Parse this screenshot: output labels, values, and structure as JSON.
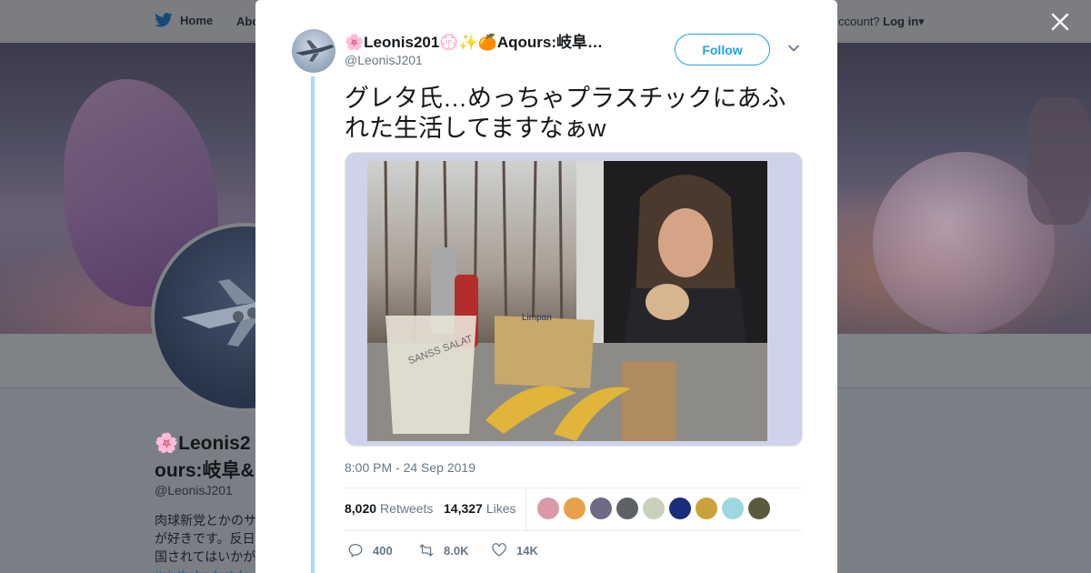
{
  "nav": {
    "home": "Home",
    "about": "Abo",
    "account_prompt": "ccount?",
    "login": "Log in"
  },
  "profile": {
    "name_line1": "🌸Leonis2",
    "name_line2": "ours:岐阜&",
    "handle": "@LeonisJ201",
    "bio_lines": [
      "肉球新党とかのサ",
      "が好きです。反日",
      "国されてはいかが"
    ],
    "bio_link": "#sinthebodystyle"
  },
  "tweet": {
    "author_name": "🌸Leonis201💮✨🍊Aqours:岐阜…",
    "author_handle": "@LeonisJ201",
    "follow_label": "Follow",
    "text": "グレタ氏…めっちゃプラスチックにあふれた生活してますなぁw",
    "timestamp": "8:00 PM - 24 Sep 2019",
    "retweets_count": "8,020",
    "retweets_label": "Retweets",
    "likes_count": "14,327",
    "likes_label": "Likes",
    "actions": {
      "reply_count": "400",
      "retweet_count": "8.0K",
      "like_count": "14K"
    },
    "likers": [
      {
        "name": "liker-avatar-1",
        "color": "#d79aa6"
      },
      {
        "name": "liker-avatar-2",
        "color": "#e8a14a"
      },
      {
        "name": "liker-avatar-3",
        "color": "#6f6a86"
      },
      {
        "name": "liker-avatar-4",
        "color": "#5d6166"
      },
      {
        "name": "liker-avatar-5",
        "color": "#c9d2b9"
      },
      {
        "name": "liker-avatar-6",
        "color": "#1a2d7a"
      },
      {
        "name": "liker-avatar-7",
        "color": "#c9a23b"
      },
      {
        "name": "liker-avatar-8",
        "color": "#9fd7e0"
      },
      {
        "name": "liker-avatar-9",
        "color": "#5a5a3e"
      }
    ],
    "media_label_left": "SANSS SALAT",
    "media_label_right": "Limpan"
  },
  "colors": {
    "accent": "#1da1f2",
    "thread_line": "#a7dbf7",
    "overlay": "#7a7f85"
  }
}
